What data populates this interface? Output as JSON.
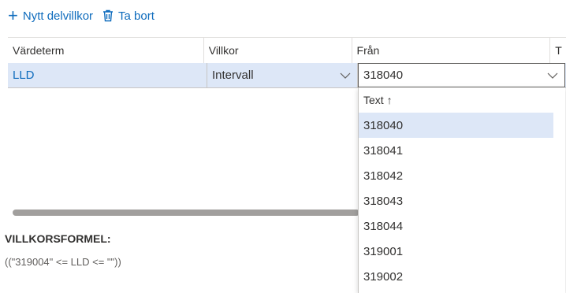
{
  "toolbar": {
    "add_label": "Nytt delvillkor",
    "delete_label": "Ta bort"
  },
  "grid": {
    "columns": [
      "Värdeterm",
      "Villkor",
      "Från",
      "T"
    ],
    "row": {
      "value_term": "LLD",
      "condition": "Intervall",
      "from": "318040"
    }
  },
  "dropdown": {
    "header": "Text ↑",
    "options": [
      "318040",
      "318041",
      "318042",
      "318043",
      "318044",
      "319001",
      "319002"
    ],
    "selected": "318040"
  },
  "formula": {
    "title": "VILLKORSFORMEL:",
    "text": "((\"319004\" <= LLD <= \"\"))"
  },
  "colors": {
    "accent": "#0f6cbd",
    "selected_row": "#dde7f7"
  }
}
